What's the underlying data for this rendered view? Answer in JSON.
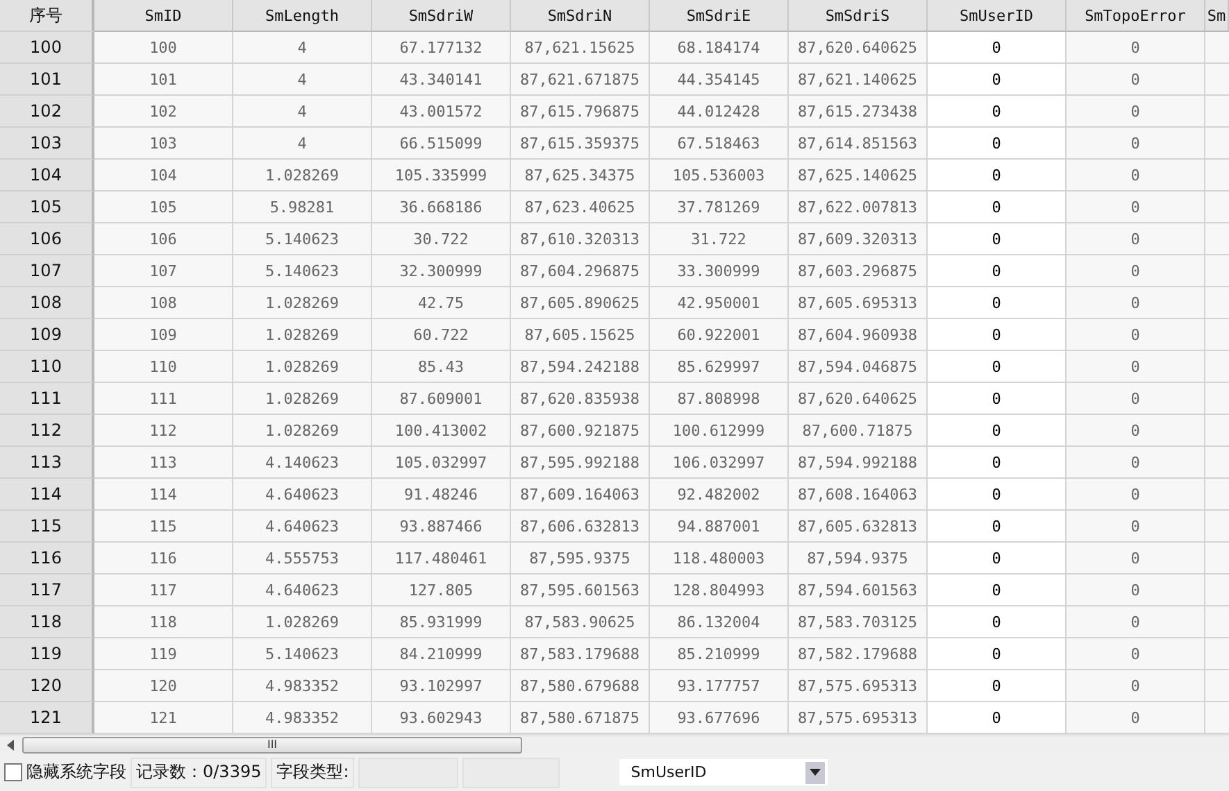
{
  "table": {
    "row_header": "序号",
    "columns": [
      {
        "label": "SmID",
        "selected": false
      },
      {
        "label": "SmLength",
        "selected": false
      },
      {
        "label": "SmSdriW",
        "selected": false
      },
      {
        "label": "SmSdriN",
        "selected": false
      },
      {
        "label": "SmSdriE",
        "selected": false
      },
      {
        "label": "SmSdriS",
        "selected": false
      },
      {
        "label": "SmUserID",
        "selected": true
      },
      {
        "label": "SmTopoError",
        "selected": false
      },
      {
        "label": "Sm"
      }
    ],
    "rows": [
      {
        "number": "100",
        "cells": [
          "100",
          "4",
          "67.177132",
          "87,621.15625",
          "68.184174",
          "87,620.640625",
          "0",
          "0"
        ]
      },
      {
        "number": "101",
        "cells": [
          "101",
          "4",
          "43.340141",
          "87,621.671875",
          "44.354145",
          "87,621.140625",
          "0",
          "0"
        ]
      },
      {
        "number": "102",
        "cells": [
          "102",
          "4",
          "43.001572",
          "87,615.796875",
          "44.012428",
          "87,615.273438",
          "0",
          "0"
        ]
      },
      {
        "number": "103",
        "cells": [
          "103",
          "4",
          "66.515099",
          "87,615.359375",
          "67.518463",
          "87,614.851563",
          "0",
          "0"
        ]
      },
      {
        "number": "104",
        "cells": [
          "104",
          "1.028269",
          "105.335999",
          "87,625.34375",
          "105.536003",
          "87,625.140625",
          "0",
          "0"
        ]
      },
      {
        "number": "105",
        "cells": [
          "105",
          "5.98281",
          "36.668186",
          "87,623.40625",
          "37.781269",
          "87,622.007813",
          "0",
          "0"
        ]
      },
      {
        "number": "106",
        "cells": [
          "106",
          "5.140623",
          "30.722",
          "87,610.320313",
          "31.722",
          "87,609.320313",
          "0",
          "0"
        ]
      },
      {
        "number": "107",
        "cells": [
          "107",
          "5.140623",
          "32.300999",
          "87,604.296875",
          "33.300999",
          "87,603.296875",
          "0",
          "0"
        ]
      },
      {
        "number": "108",
        "cells": [
          "108",
          "1.028269",
          "42.75",
          "87,605.890625",
          "42.950001",
          "87,605.695313",
          "0",
          "0"
        ]
      },
      {
        "number": "109",
        "cells": [
          "109",
          "1.028269",
          "60.722",
          "87,605.15625",
          "60.922001",
          "87,604.960938",
          "0",
          "0"
        ]
      },
      {
        "number": "110",
        "cells": [
          "110",
          "1.028269",
          "85.43",
          "87,594.242188",
          "85.629997",
          "87,594.046875",
          "0",
          "0"
        ]
      },
      {
        "number": "111",
        "cells": [
          "111",
          "1.028269",
          "87.609001",
          "87,620.835938",
          "87.808998",
          "87,620.640625",
          "0",
          "0"
        ]
      },
      {
        "number": "112",
        "cells": [
          "112",
          "1.028269",
          "100.413002",
          "87,600.921875",
          "100.612999",
          "87,600.71875",
          "0",
          "0"
        ]
      },
      {
        "number": "113",
        "cells": [
          "113",
          "4.140623",
          "105.032997",
          "87,595.992188",
          "106.032997",
          "87,594.992188",
          "0",
          "0"
        ]
      },
      {
        "number": "114",
        "cells": [
          "114",
          "4.640623",
          "91.48246",
          "87,609.164063",
          "92.482002",
          "87,608.164063",
          "0",
          "0"
        ]
      },
      {
        "number": "115",
        "cells": [
          "115",
          "4.640623",
          "93.887466",
          "87,606.632813",
          "94.887001",
          "87,605.632813",
          "0",
          "0"
        ]
      },
      {
        "number": "116",
        "cells": [
          "116",
          "4.555753",
          "117.480461",
          "87,595.9375",
          "118.480003",
          "87,594.9375",
          "0",
          "0"
        ]
      },
      {
        "number": "117",
        "cells": [
          "117",
          "4.640623",
          "127.805",
          "87,595.601563",
          "128.804993",
          "87,594.601563",
          "0",
          "0"
        ]
      },
      {
        "number": "118",
        "cells": [
          "118",
          "1.028269",
          "85.931999",
          "87,583.90625",
          "86.132004",
          "87,583.703125",
          "0",
          "0"
        ]
      },
      {
        "number": "119",
        "cells": [
          "119",
          "5.140623",
          "84.210999",
          "87,583.179688",
          "85.210999",
          "87,582.179688",
          "0",
          "0"
        ]
      },
      {
        "number": "120",
        "cells": [
          "120",
          "4.983352",
          "93.102997",
          "87,580.679688",
          "93.177757",
          "87,575.695313",
          "0",
          "0"
        ]
      },
      {
        "number": "121",
        "cells": [
          "121",
          "4.983352",
          "93.602943",
          "87,580.671875",
          "93.677696",
          "87,575.695313",
          "0",
          "0"
        ]
      }
    ]
  },
  "scrollbar_grip": "III",
  "status_bar": {
    "hide_system_fields": {
      "label": "隐藏系统字段",
      "checked": false
    },
    "record_count": "记录数：0/3395",
    "field_type_label": "字段类型:",
    "field_select": {
      "value": "SmUserID"
    }
  }
}
